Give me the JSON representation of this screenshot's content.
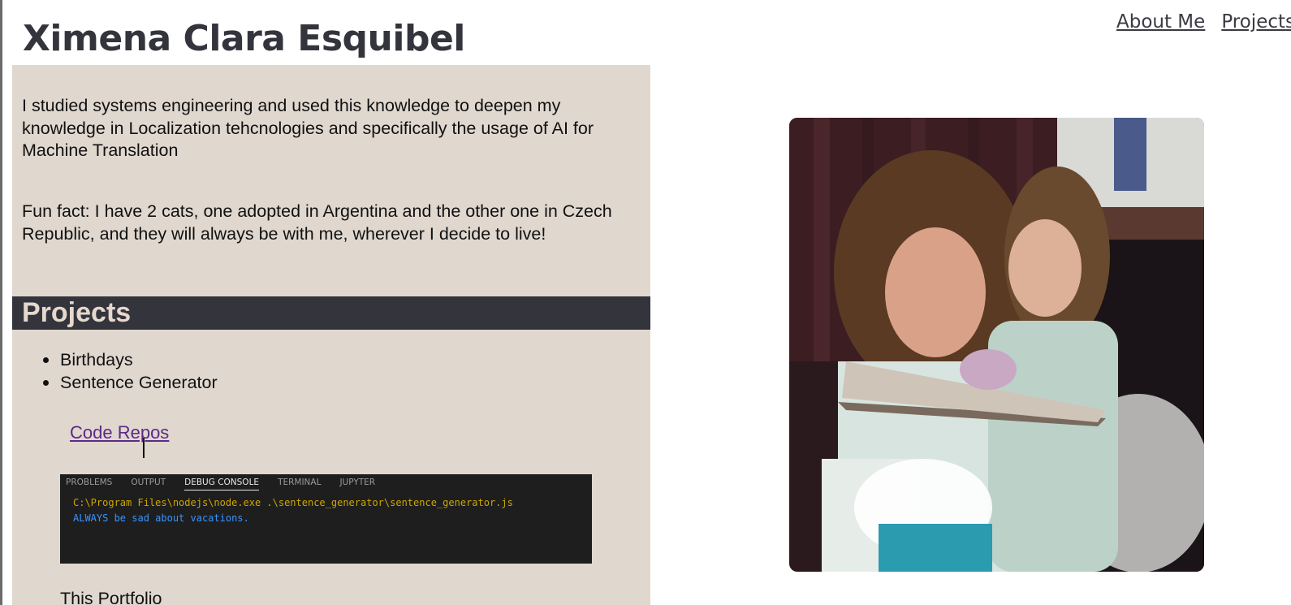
{
  "header": {
    "site_title": "Ximena Clara Esquibel",
    "nav": [
      {
        "label": "About Me"
      },
      {
        "label": "Projects"
      }
    ]
  },
  "about": {
    "paragraph_1": "I studied systems engineering and used this knowledge to deepen my knowledge in Localization tehcnologies and specifically the usage of AI for Machine Translation",
    "paragraph_2": "Fun fact: I have 2 cats, one adopted in Argentina and the other one in Czech Republic, and they will always be with me, wherever I decide to live!"
  },
  "projects": {
    "heading": "Projects",
    "items": [
      {
        "label": "Birthdays"
      },
      {
        "label": "Sentence Generator"
      }
    ],
    "code_repos_label": "Code Repos",
    "console": {
      "tabs": [
        {
          "label": "PROBLEMS",
          "active": false
        },
        {
          "label": "OUTPUT",
          "active": false
        },
        {
          "label": "DEBUG CONSOLE",
          "active": true
        },
        {
          "label": "TERMINAL",
          "active": false
        },
        {
          "label": "JUPYTER",
          "active": false
        }
      ],
      "lines": [
        "C:\\Program Files\\nodejs\\node.exe .\\sentence_generator\\sentence_generator.js",
        "ALWAYS be sad about vacations."
      ]
    },
    "next_item": "This Portfolio"
  },
  "colors": {
    "panel_bg": "#e0d7cf",
    "heading_bar": "#34343d",
    "heading_text": "#e6d8cc",
    "link_visited": "#5b2a86",
    "console_bg": "#1e1e1e",
    "console_path": "#cca700",
    "console_output": "#3794ff"
  },
  "image": {
    "icon": "family-photo"
  }
}
